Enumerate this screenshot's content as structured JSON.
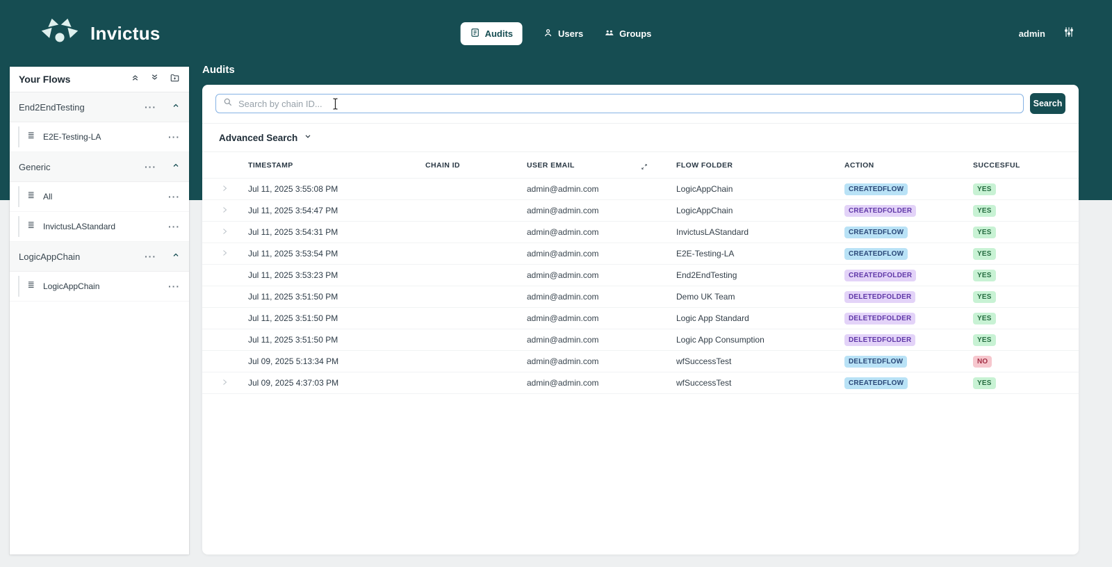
{
  "colors": {
    "accent_teal": "#164d52",
    "page_background": "#eef0f1",
    "badge_flow_bg": "#b9e2f6",
    "badge_flow_text": "#2a4878",
    "badge_folder_bg": "#e3d3f8",
    "badge_folder_text": "#6038a8",
    "badge_yes_bg": "#c8f2d4",
    "badge_yes_text": "#256c40",
    "badge_no_bg": "#f6c7ce",
    "badge_no_text": "#a32e44",
    "search_focus_border": "#85b2e4"
  },
  "icons": {
    "logo": "abstract-star-eye-mark",
    "audits-tab": "journal-lines",
    "users-tab": "person",
    "groups-tab": "people",
    "settings": "vertical-sliders",
    "collapse-all": "double-chevron-up",
    "expand-all": "double-chevron-down",
    "new-folder": "folder-plus",
    "folder-collapse": "chevron-up",
    "flow-item": "stacked-lines",
    "search": "magnifier",
    "advanced-toggle": "chevron-down",
    "row-expand": "chevron-right",
    "column-resize": "diagonal-double-arrow",
    "text-cursor": "i-beam"
  },
  "header": {
    "brand": "Invictus",
    "nav": {
      "audits": "Audits",
      "users": "Users",
      "groups": "Groups"
    },
    "username": "admin"
  },
  "sidebar": {
    "title": "Your Flows",
    "menu_dots": "···",
    "sections": [
      {
        "name": "End2EndTesting",
        "items": [
          {
            "name": "E2E-Testing-LA"
          }
        ]
      },
      {
        "name": "Generic",
        "items": [
          {
            "name": "All"
          },
          {
            "name": "InvictusLAStandard"
          }
        ]
      },
      {
        "name": "LogicAppChain",
        "items": [
          {
            "name": "LogicAppChain"
          }
        ]
      }
    ]
  },
  "main": {
    "page_title": "Audits",
    "search_placeholder": "Search by chain ID...",
    "search_button": "Search",
    "advanced_search_label": "Advanced Search",
    "table": {
      "columns": [
        "TIMESTAMP",
        "CHAIN ID",
        "USER EMAIL",
        "FLOW FOLDER",
        "ACTION",
        "SUCCESFUL"
      ],
      "rows": [
        {
          "expandable": true,
          "timestamp": "Jul 11, 2025 3:55:08 PM",
          "chain_id": "",
          "user_email": "admin@admin.com",
          "flow_folder": "LogicAppChain",
          "action": "CREATEDFLOW",
          "action_kind": "flow",
          "successful": "YES"
        },
        {
          "expandable": true,
          "timestamp": "Jul 11, 2025 3:54:47 PM",
          "chain_id": "",
          "user_email": "admin@admin.com",
          "flow_folder": "LogicAppChain",
          "action": "CREATEDFOLDER",
          "action_kind": "folder",
          "successful": "YES"
        },
        {
          "expandable": true,
          "timestamp": "Jul 11, 2025 3:54:31 PM",
          "chain_id": "",
          "user_email": "admin@admin.com",
          "flow_folder": "InvictusLAStandard",
          "action": "CREATEDFLOW",
          "action_kind": "flow",
          "successful": "YES"
        },
        {
          "expandable": true,
          "timestamp": "Jul 11, 2025 3:53:54 PM",
          "chain_id": "",
          "user_email": "admin@admin.com",
          "flow_folder": "E2E-Testing-LA",
          "action": "CREATEDFLOW",
          "action_kind": "flow",
          "successful": "YES"
        },
        {
          "expandable": false,
          "timestamp": "Jul 11, 2025 3:53:23 PM",
          "chain_id": "",
          "user_email": "admin@admin.com",
          "flow_folder": "End2EndTesting",
          "action": "CREATEDFOLDER",
          "action_kind": "folder",
          "successful": "YES"
        },
        {
          "expandable": false,
          "timestamp": "Jul 11, 2025 3:51:50 PM",
          "chain_id": "",
          "user_email": "admin@admin.com",
          "flow_folder": "Demo UK Team",
          "action": "DELETEDFOLDER",
          "action_kind": "folder",
          "successful": "YES"
        },
        {
          "expandable": false,
          "timestamp": "Jul 11, 2025 3:51:50 PM",
          "chain_id": "",
          "user_email": "admin@admin.com",
          "flow_folder": "Logic App Standard",
          "action": "DELETEDFOLDER",
          "action_kind": "folder",
          "successful": "YES"
        },
        {
          "expandable": false,
          "timestamp": "Jul 11, 2025 3:51:50 PM",
          "chain_id": "",
          "user_email": "admin@admin.com",
          "flow_folder": "Logic App Consumption",
          "action": "DELETEDFOLDER",
          "action_kind": "folder",
          "successful": "YES"
        },
        {
          "expandable": false,
          "timestamp": "Jul 09, 2025 5:13:34 PM",
          "chain_id": "",
          "user_email": "admin@admin.com",
          "flow_folder": "wfSuccessTest",
          "action": "DELETEDFLOW",
          "action_kind": "flow",
          "successful": "NO"
        },
        {
          "expandable": true,
          "timestamp": "Jul 09, 2025 4:37:03 PM",
          "chain_id": "",
          "user_email": "admin@admin.com",
          "flow_folder": "wfSuccessTest",
          "action": "CREATEDFLOW",
          "action_kind": "flow",
          "successful": "YES"
        }
      ]
    }
  }
}
